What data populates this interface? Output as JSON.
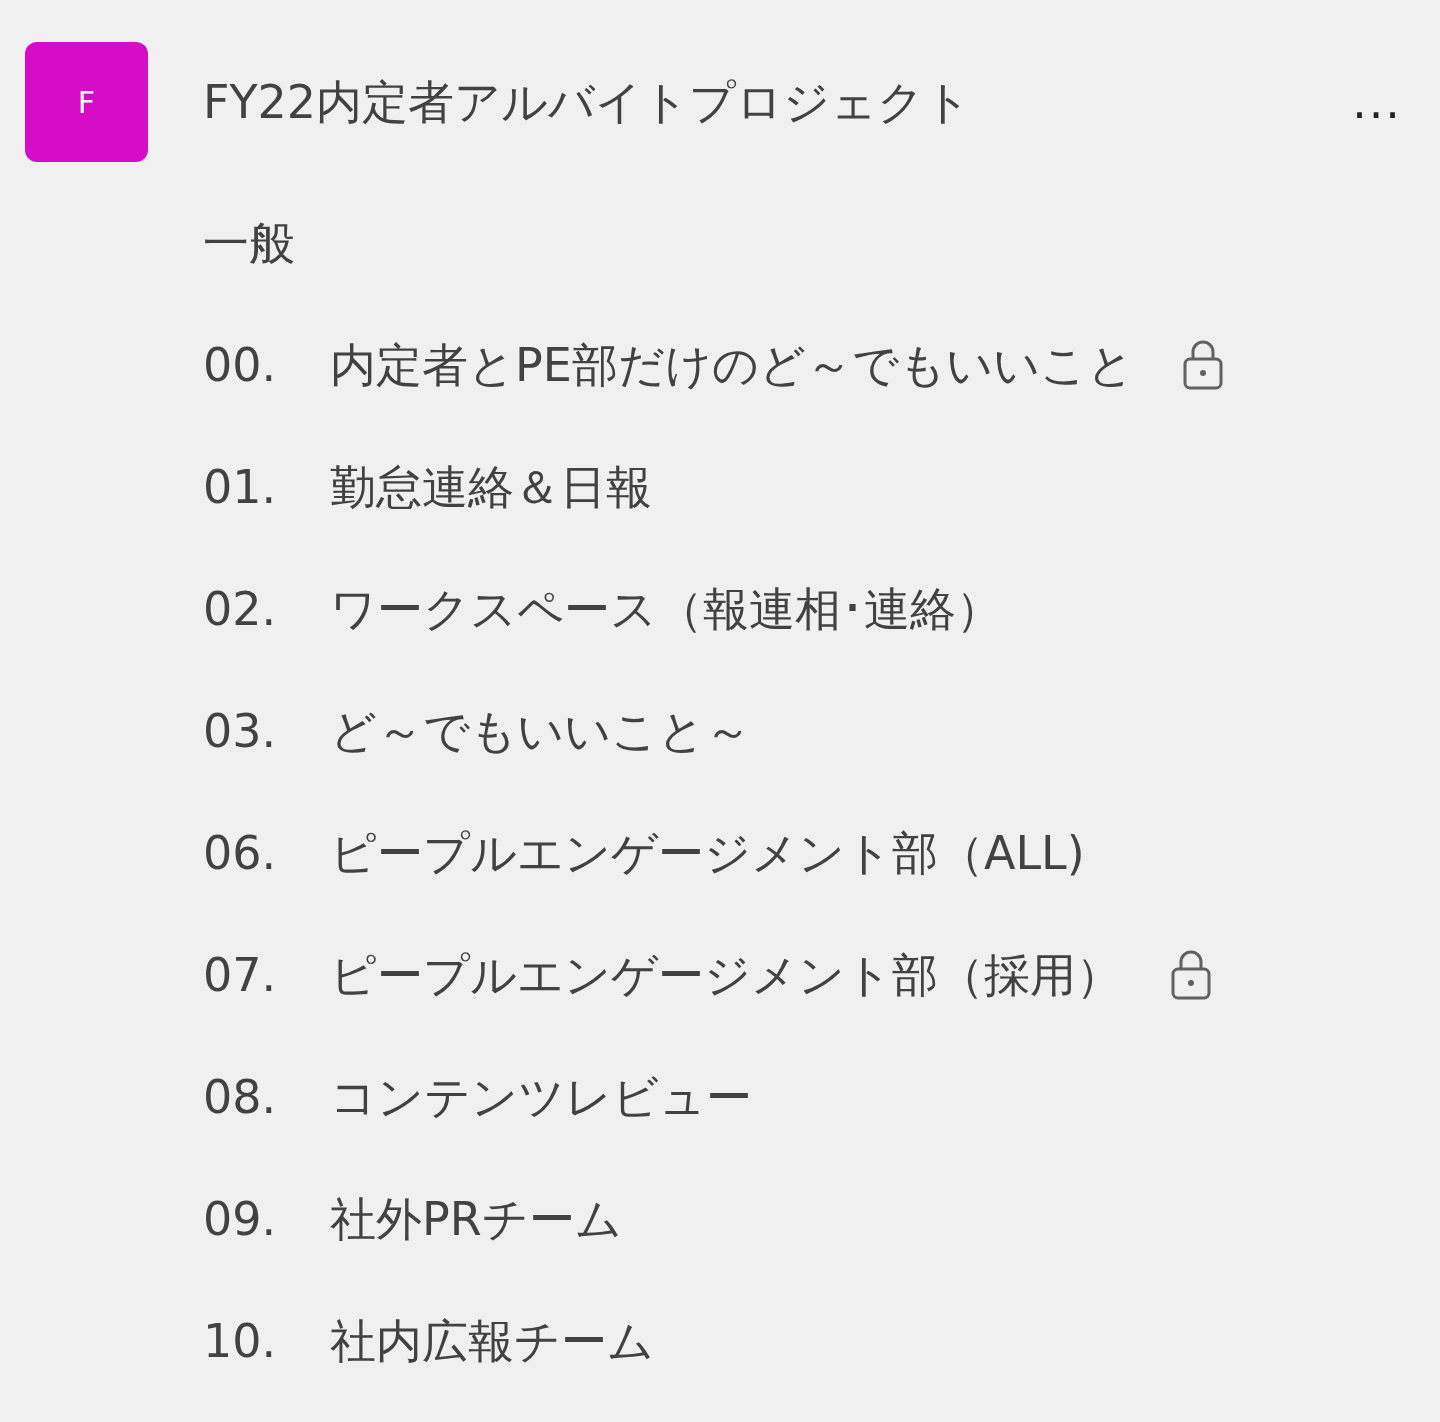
{
  "team": {
    "avatar_letter": "F",
    "name": "FY22内定者アルバイトプロジェクト",
    "more": "..."
  },
  "channels": [
    {
      "name": "一般",
      "private": false
    },
    {
      "number": "00.",
      "name": "内定者とPE部だけのど～でもいいこと",
      "private": true
    },
    {
      "number": "01.",
      "name": "勤怠連絡＆日報",
      "private": false
    },
    {
      "number": "02.",
      "name": "ワークスペース（報連相･連絡）",
      "private": false
    },
    {
      "number": "03.",
      "name": "ど～でもいいこと～",
      "private": false
    },
    {
      "number": "06.",
      "name": "ピープルエンゲージメント部（ALL)",
      "private": false
    },
    {
      "number": "07.",
      "name": "ピープルエンゲージメント部（採用）",
      "private": true
    },
    {
      "number": "08.",
      "name": "コンテンツレビュー",
      "private": false
    },
    {
      "number": "09.",
      "name": "社外PRチーム",
      "private": false
    },
    {
      "number": "10.",
      "name": "社内広報チーム",
      "private": false
    }
  ]
}
